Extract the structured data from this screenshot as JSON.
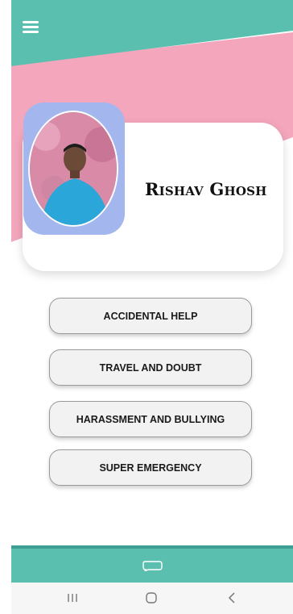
{
  "colors": {
    "teal": "#5bbfb0",
    "pink": "#f4a6bc",
    "avatar_frame": "#a3b6ee",
    "button_bg": "#f2f2f2"
  },
  "header": {
    "menu_icon": "hamburger-menu-icon"
  },
  "profile": {
    "name": "Rishav Ghosh"
  },
  "menu": {
    "buttons": [
      {
        "label": "ACCIDENTAL HELP"
      },
      {
        "label": "TRAVEL AND DOUBT"
      },
      {
        "label": "HARASSMENT AND BULLYING"
      },
      {
        "label": "SUPER EMERGENCY"
      }
    ]
  },
  "bottom_bar": {
    "icon": "chat-bubble-icon"
  },
  "system_nav": {
    "recents_icon": "recents-icon",
    "home_icon": "home-icon",
    "back_icon": "back-icon"
  }
}
